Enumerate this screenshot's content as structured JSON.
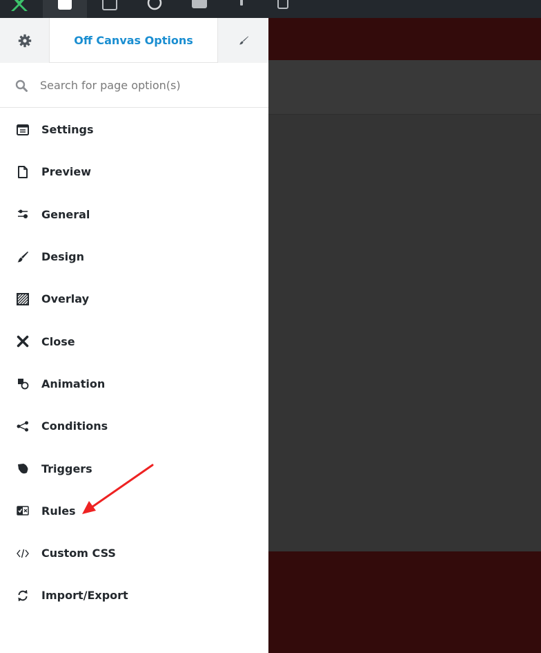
{
  "header": {
    "title": "Off Canvas Options"
  },
  "search": {
    "placeholder": "Search for page option(s)",
    "value": ""
  },
  "menu": {
    "items": [
      {
        "label": "Settings"
      },
      {
        "label": "Preview"
      },
      {
        "label": "General"
      },
      {
        "label": "Design"
      },
      {
        "label": "Overlay"
      },
      {
        "label": "Close"
      },
      {
        "label": "Animation"
      },
      {
        "label": "Conditions"
      },
      {
        "label": "Triggers"
      },
      {
        "label": "Rules"
      },
      {
        "label": "Custom CSS"
      },
      {
        "label": "Import/Export"
      }
    ]
  },
  "colors": {
    "accent": "#1a8ed1",
    "toolbar": "#23282d",
    "canvas_band": "#330b0b",
    "annotation_arrow": "#ee2222"
  }
}
